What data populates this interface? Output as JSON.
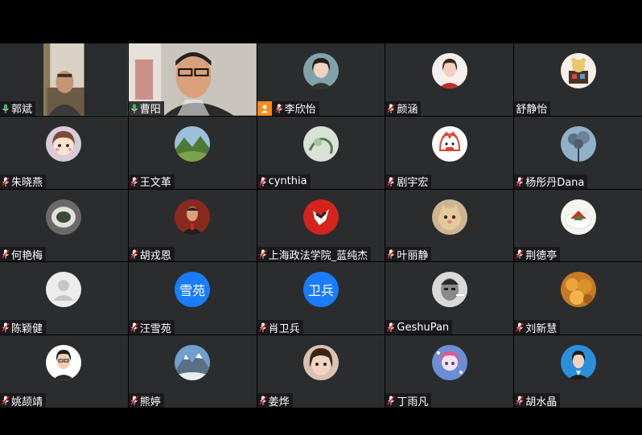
{
  "colors": {
    "background": "#000000",
    "tile": "#2b2c2e",
    "active_border": "#22c55e",
    "muted_mic": "#e02020",
    "live_mic": "#22c55e",
    "text_avatar": "#1a7cff",
    "host_badge": "#ff8a1a"
  },
  "participants": [
    {
      "name": "郭斌",
      "mic": "live",
      "type": "video",
      "avatar": "man-glasses-video",
      "active": true
    },
    {
      "name": "曹阳",
      "mic": "live",
      "type": "video",
      "avatar": "man-glasses-closeup-video"
    },
    {
      "name": "李欣怡",
      "mic": "muted",
      "host": true,
      "avatar": "girl-photo-avatar"
    },
    {
      "name": "颜涵",
      "mic": "muted",
      "avatar": "girl-white-shirt-avatar"
    },
    {
      "name": "舒静怡",
      "mic": "none",
      "avatar": "cartoon-bear-avatar"
    },
    {
      "name": "朱晓燕",
      "mic": "muted",
      "avatar": "cartoon-girl-avatar"
    },
    {
      "name": "王文革",
      "mic": "muted",
      "avatar": "mountain-landscape-avatar"
    },
    {
      "name": "cynthia",
      "mic": "muted",
      "avatar": "green-sketch-avatar"
    },
    {
      "name": "剧宇宏",
      "mic": "muted",
      "avatar": "cartoon-character-avatar"
    },
    {
      "name": "杨彤丹Dana",
      "mic": "muted",
      "avatar": "blue-tree-avatar"
    },
    {
      "name": "何艳梅",
      "mic": "muted",
      "avatar": "plate-avatar"
    },
    {
      "name": "胡戎恩",
      "mic": "muted",
      "avatar": "man-portrait-avatar"
    },
    {
      "name": "上海政法学院_蓝纯杰",
      "mic": "muted",
      "avatar": "red-logo-avatar"
    },
    {
      "name": "叶丽静",
      "mic": "muted",
      "avatar": "cat-avatar"
    },
    {
      "name": "荆德亭",
      "mic": "muted",
      "avatar": "food-dish-avatar"
    },
    {
      "name": "陈颖健",
      "mic": "muted",
      "avatar": "default-person-avatar"
    },
    {
      "name": "汪雪苑",
      "mic": "muted",
      "avatar_text": "雪苑"
    },
    {
      "name": "肖卫兵",
      "mic": "muted",
      "avatar_text": "卫兵"
    },
    {
      "name": "GeshuPan",
      "mic": "muted",
      "avatar": "bw-portrait-avatar"
    },
    {
      "name": "刘新慧",
      "mic": "muted",
      "avatar": "snack-avatar"
    },
    {
      "name": "姚颉靖",
      "mic": "muted",
      "avatar": "woman-glasses-avatar"
    },
    {
      "name": "熊婷",
      "mic": "muted",
      "avatar": "snowy-mountain-avatar"
    },
    {
      "name": "姜烨",
      "mic": "muted",
      "avatar": "girl-closeup-avatar"
    },
    {
      "name": "丁雨凡",
      "mic": "muted",
      "avatar": "anime-girl-avatar"
    },
    {
      "name": "胡水晶",
      "mic": "muted",
      "avatar": "woman-blue-background-avatar"
    }
  ]
}
